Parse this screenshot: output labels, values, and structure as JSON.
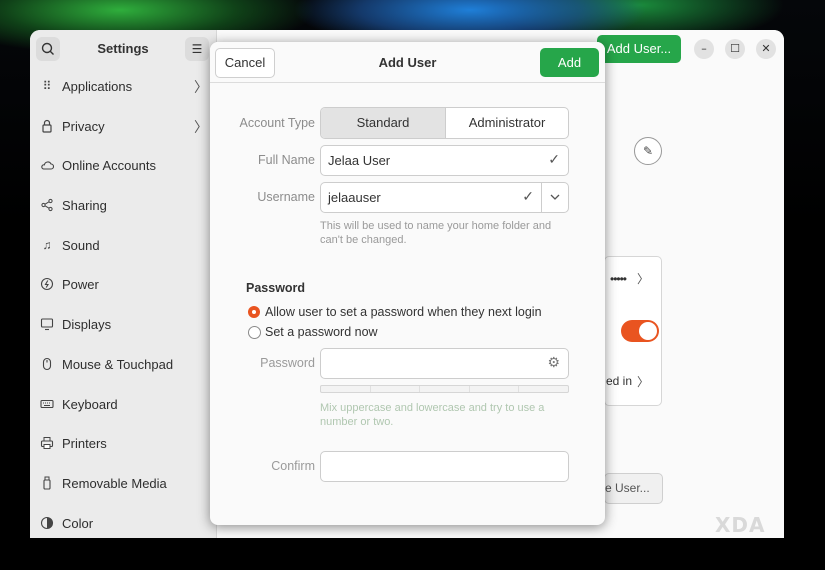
{
  "sidebar": {
    "title": "Settings",
    "items": [
      {
        "label": "Applications",
        "icon": "apps-grid-icon",
        "has_arrow": true
      },
      {
        "label": "Privacy",
        "icon": "lock-icon",
        "has_arrow": true
      },
      {
        "label": "Online Accounts",
        "icon": "cloud-icon",
        "has_arrow": false
      },
      {
        "label": "Sharing",
        "icon": "share-icon",
        "has_arrow": false
      },
      {
        "label": "Sound",
        "icon": "music-note-icon",
        "has_arrow": false
      },
      {
        "label": "Power",
        "icon": "power-icon",
        "has_arrow": false
      },
      {
        "label": "Displays",
        "icon": "display-icon",
        "has_arrow": false
      },
      {
        "label": "Mouse & Touchpad",
        "icon": "mouse-icon",
        "has_arrow": false
      },
      {
        "label": "Keyboard",
        "icon": "keyboard-icon",
        "has_arrow": false
      },
      {
        "label": "Printers",
        "icon": "printer-icon",
        "has_arrow": false
      },
      {
        "label": "Removable Media",
        "icon": "usb-drive-icon",
        "has_arrow": false
      },
      {
        "label": "Color",
        "icon": "color-icon",
        "has_arrow": false
      }
    ]
  },
  "main": {
    "add_user_label": "Add User...",
    "password_mask": "•••••",
    "logged_in_text": "ed in",
    "remove_user_text": "e User..."
  },
  "dialog": {
    "cancel_label": "Cancel",
    "title": "Add User",
    "add_label": "Add",
    "account_type_label": "Account Type",
    "account_type_options": [
      "Standard",
      "Administrator"
    ],
    "account_type_selected": "Standard",
    "full_name_label": "Full Name",
    "full_name_value": "Jelaa User",
    "username_label": "Username",
    "username_value": "jelaauser",
    "username_hint": "This will be used to name your home folder and can't be changed.",
    "password_section": "Password",
    "password_option_1": "Allow user to set a password when they next login",
    "password_option_2": "Set a password now",
    "password_field_label": "Password",
    "password_hint": "Mix uppercase and lowercase and try to use a number or two.",
    "confirm_label": "Confirm"
  },
  "watermark": "XDA",
  "colors": {
    "accent_green": "#26a64a",
    "accent_orange": "#e95420"
  }
}
